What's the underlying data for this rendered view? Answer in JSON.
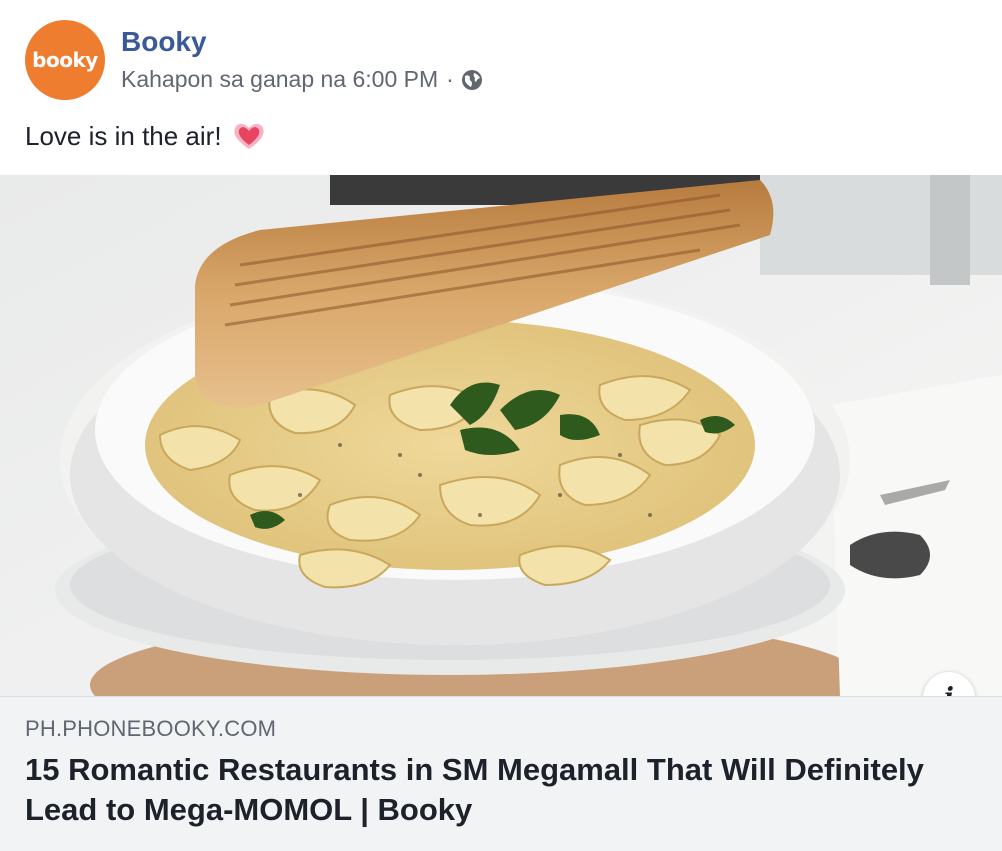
{
  "post": {
    "page_name": "Booky",
    "avatar_text": "booky",
    "timestamp": "Kahapon sa ganap na 6:00 PM",
    "separator": "·",
    "privacy_icon": "globe-icon",
    "message": "Love is in the air!",
    "emoji_icon": "heart-icon"
  },
  "link_preview": {
    "image_description_icon": "food-photo",
    "info_button_label": "i",
    "domain": "PH.PHONEBOOKY.COM",
    "title": "15 Romantic Restaurants in SM Megamall That Will Definitely Lead to Mega-MOMOL | Booky"
  },
  "colors": {
    "brand_orange": "#ee7d2f",
    "link_blue": "#3b5998",
    "meta_gray": "#616770",
    "preview_bg": "#f2f3f5"
  }
}
